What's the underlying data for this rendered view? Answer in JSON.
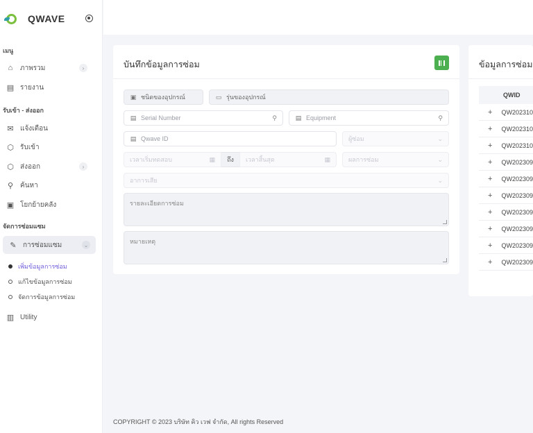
{
  "brand": {
    "name": "QWAVE"
  },
  "sidebar": {
    "sections": {
      "menu": "เมนู",
      "receive": "รับเข้า - ส่งออก",
      "repair": "จัดการซ่อมแซม"
    },
    "items": {
      "overview": {
        "label": "ภาพรวม",
        "icon": "home-icon"
      },
      "report": {
        "label": "รายงาน",
        "icon": "report-icon"
      },
      "notify": {
        "label": "แจ้งเตือน",
        "icon": "mail-icon"
      },
      "receive_in": {
        "label": "รับเข้า",
        "icon": "box-in-icon"
      },
      "send_out": {
        "label": "ส่งออก",
        "icon": "box-out-icon"
      },
      "search": {
        "label": "ค้นหา",
        "icon": "search-icon"
      },
      "move": {
        "label": "โยกย้ายคลัง",
        "icon": "archive-icon"
      },
      "repair": {
        "label": "การซ่อมแซม",
        "icon": "wrench-icon"
      },
      "utility": {
        "label": "Utility",
        "icon": "columns-icon"
      }
    },
    "sub_items": {
      "add": "เพิ่มข้อมูลการซ่อม",
      "edit": "แก้ไขข้อมูลการซ่อม",
      "manage": "จัดการข้อมูลการซ่อม"
    }
  },
  "form": {
    "title": "บันทึกข้อมูลการซ่อม",
    "device_type": "ชนิดของอุปกรณ์",
    "device_model": "รุ่นของอุปกรณ์",
    "serial_placeholder": "Serial Number",
    "equipment_placeholder": "Equipment",
    "qwave_id_placeholder": "Qwave ID",
    "repairer_placeholder": "ผู้ซ่อม",
    "start_time_placeholder": "เวลาเริ่มทดสอบ",
    "to_label": "ถึง",
    "end_time_placeholder": "เวลาสิ้นสุด",
    "result_placeholder": "ผลการซ่อม",
    "symptom_placeholder": "อาการเสีย",
    "details_placeholder": "รายละเอียดการซ่อม",
    "note_placeholder": "หมายเหตุ"
  },
  "right_panel": {
    "title": "ข้อมูลการซ่อมส",
    "column": "QWID",
    "rows": [
      "QW202310",
      "QW202310",
      "QW202310",
      "QW202309",
      "QW202309",
      "QW202309",
      "QW202309",
      "QW202309",
      "QW202309",
      "QW202309"
    ]
  },
  "footer": {
    "text": "COPYRIGHT © 2023 บริษัท คิว เวฟ จำกัด, All rights Reserved"
  }
}
